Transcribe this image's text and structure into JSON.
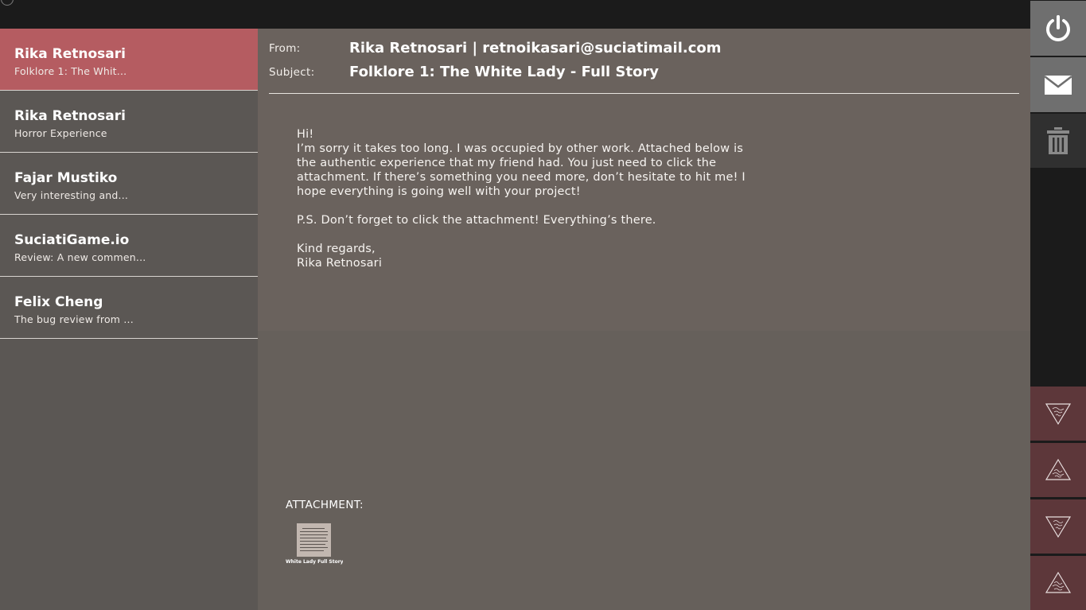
{
  "inbox": {
    "items": [
      {
        "sender": "Rika Retnosari",
        "preview": "Folklore 1: The Whit...",
        "active": true
      },
      {
        "sender": "Rika Retnosari",
        "preview": "Horror Experience",
        "active": false
      },
      {
        "sender": "Fajar Mustiko",
        "preview": "Very interesting and...",
        "active": false
      },
      {
        "sender": "SuciatiGame.io",
        "preview": "Review: A new commen...",
        "active": false
      },
      {
        "sender": "Felix Cheng",
        "preview": "The bug review from ...",
        "active": false
      }
    ]
  },
  "message": {
    "from_label": "From:",
    "from_value": "Rika Retnosari | retnoikasari@suciatimail.com",
    "subject_label": "Subject:",
    "subject_value": "Folklore 1: The White Lady - Full Story",
    "body": {
      "greeting": "Hi!",
      "paragraph": "I’m sorry it takes too long. I was occupied by other work. Attached below is the authentic experience that my friend had. You just need to click the attachment. If there’s something you need more, don’t hesitate to hit me! I hope everything is going well with your project!",
      "ps": "P.S. Don’t forget to click the attachment! Everything’s there.",
      "closing": "Kind regards,",
      "signature": "Rika Retnosari"
    },
    "attachment_label": "ATTACHMENT:",
    "attachment_name": "White Lady Full Story.d"
  },
  "sidebar_icons": {
    "power": "power-icon",
    "mail": "envelope-icon",
    "trash": "trash-icon",
    "folklore": [
      "folklore-triangle-down-icon",
      "folklore-triangle-up-icon",
      "folklore-triangle-down-icon",
      "folklore-triangle-up-icon"
    ]
  },
  "colors": {
    "active_item": "#b55c61",
    "inbox_bg": "#5b5754",
    "reader_bg": "#66605b",
    "message_panel_bg": "#6a625d",
    "topbar_bg": "#1b1b1b",
    "folklore_btn": "#5d373a",
    "system_btn": "#6f6f6f"
  }
}
